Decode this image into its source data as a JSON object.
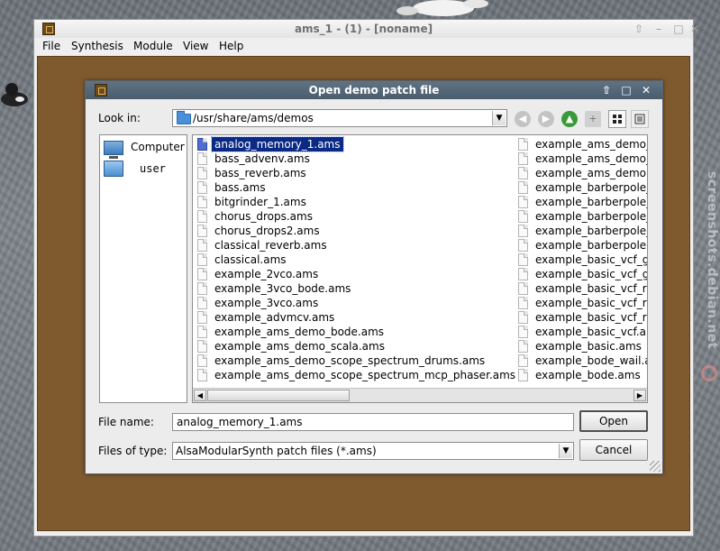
{
  "main_window": {
    "title": "ams_1 - (1) - [noname]",
    "controls": {
      "up": "⇧",
      "minimize": "–",
      "maximize": "□",
      "close": "✕"
    },
    "menu": [
      {
        "label": "File"
      },
      {
        "label": "Synthesis"
      },
      {
        "label": "Module"
      },
      {
        "label": "View"
      },
      {
        "label": "Help"
      }
    ]
  },
  "dialog": {
    "title": "Open demo patch file",
    "controls": {
      "up": "⇧",
      "maximize": "□",
      "close": "✕"
    },
    "look_in": {
      "label": "Look in:",
      "path": "/usr/share/ams/demos"
    },
    "nav_icons": [
      "back-icon",
      "forward-icon",
      "parent-dir-icon",
      "new-folder-icon",
      "icon-view-icon",
      "detail-view-icon"
    ],
    "sidebar": [
      {
        "label": "Computer",
        "icon": "computer-icon"
      },
      {
        "label": "user",
        "icon": "user-folder-icon"
      }
    ],
    "files_col1": [
      "analog_memory_1.ams",
      "bass_advenv.ams",
      "bass_reverb.ams",
      "bass.ams",
      "bitgrinder_1.ams",
      "chorus_drops.ams",
      "chorus_drops2.ams",
      "classical_reverb.ams",
      "classical.ams",
      "example_2vco.ams",
      "example_3vco_bode.ams",
      "example_3vco.ams",
      "example_advmcv.ams",
      "example_ams_demo_bode.ams",
      "example_ams_demo_scala.ams",
      "example_ams_demo_scope_spectrum_drums.ams",
      "example_ams_demo_scope_spectrum_mcp_phaser.ams"
    ],
    "files_col2": [
      "example_ams_demo_",
      "example_ams_demo_",
      "example_ams_demo.",
      "example_barberpole_",
      "example_barberpole_",
      "example_barberpole_",
      "example_barberpole_",
      "example_barberpole.",
      "example_basic_vcf_g",
      "example_basic_vcf_g",
      "example_basic_vcf_re",
      "example_basic_vcf_re",
      "example_basic_vcf_re",
      "example_basic_vcf.ar",
      "example_basic.ams",
      "example_bode_wail.a",
      "example_bode.ams"
    ],
    "selected_file": "analog_memory_1.ams",
    "file_name": {
      "label": "File name:",
      "value": "analog_memory_1.ams"
    },
    "file_type": {
      "label": "Files of type:",
      "value": "AlsaModularSynth patch files (*.ams)"
    },
    "buttons": {
      "open": "Open",
      "cancel": "Cancel"
    }
  },
  "watermark": "screenshots.debian.net",
  "colors": {
    "canvas": "#7f5a2e",
    "dialog_titlebar": "#4b5d6d",
    "selection": "#0a2a85"
  }
}
